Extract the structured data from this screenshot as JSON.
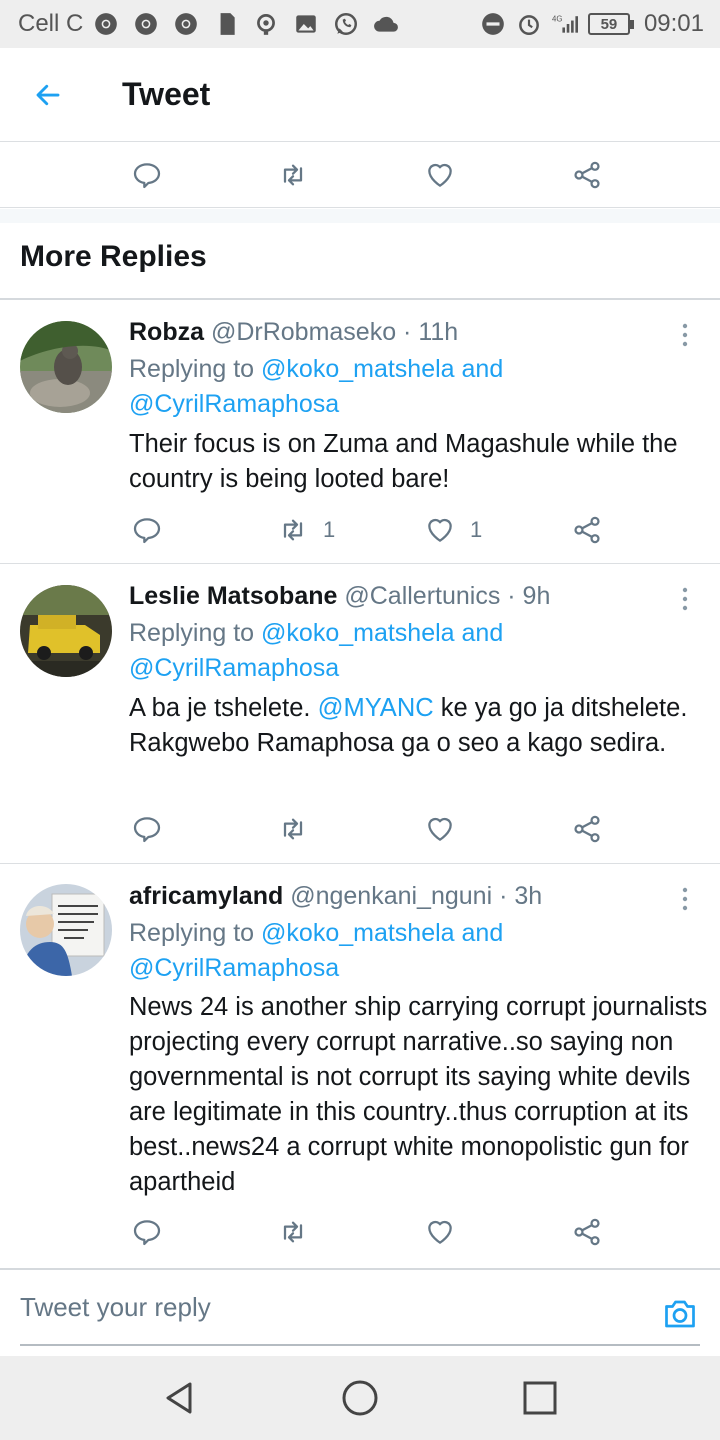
{
  "status_bar": {
    "carrier": "Cell C",
    "battery": "59",
    "network": "4G",
    "time": "09:01"
  },
  "header": {
    "title": "Tweet"
  },
  "section": {
    "title": "More Replies"
  },
  "replies": [
    {
      "name": "Robza",
      "handle": "@DrRobmaseko · 11h",
      "replying_prefix": "Replying to ",
      "replying_1": "@koko_matshela and",
      "replying_2": "@CyrilRamaphosa",
      "text": "Their focus is on Zuma and Magashule while the country is being looted bare!",
      "retweets": "1",
      "likes": "1"
    },
    {
      "name": "Leslie Matsobane",
      "handle": "@Callertunics · 9h",
      "replying_prefix": "Replying to ",
      "replying_1": "@koko_matshela and",
      "replying_2": "@CyrilRamaphosa",
      "text_1": "A ba je tshelete. ",
      "mention": "@MYANC",
      "text_2": " ke ya go ja ditshelete. Rakgwebo Ramaphosa ga o seo a kago sedira.",
      "retweets": "",
      "likes": ""
    },
    {
      "name": "africamyland",
      "handle": "@ngenkani_nguni · 3h",
      "replying_prefix": "Replying to ",
      "replying_1": "@koko_matshela and",
      "replying_2": "@CyrilRamaphosa",
      "text": "News 24 is another ship carrying corrupt journalists projecting every corrupt narrative..so saying non governmental is not corrupt its saying white devils are legitimate in this country..thus corruption at its best..news24 a corrupt white monopolistic gun for apartheid",
      "retweets": "",
      "likes": ""
    }
  ],
  "composer": {
    "placeholder": "Tweet your reply"
  },
  "colors": {
    "accent": "#1da1f2",
    "muted": "#657786",
    "text": "#14171a"
  }
}
